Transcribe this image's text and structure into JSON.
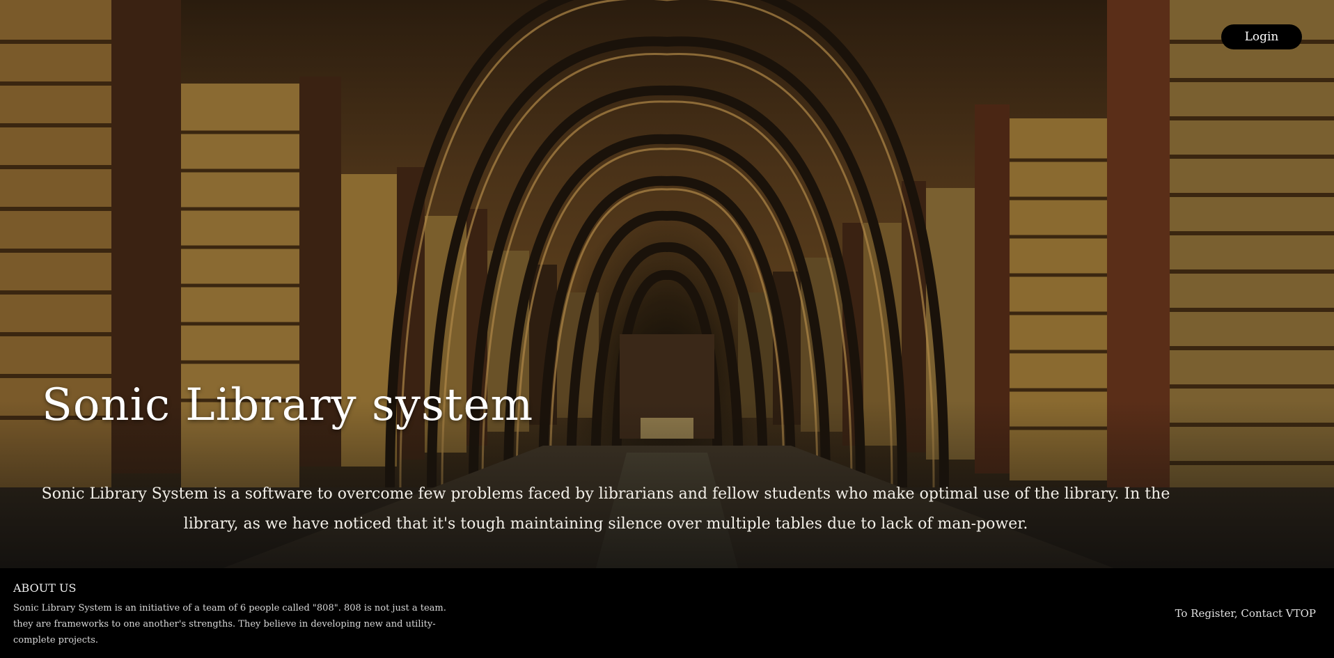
{
  "header": {
    "login_label": "Login"
  },
  "hero": {
    "title": "Sonic Library system",
    "description": "Sonic Library System is a software to overcome few problems faced by librarians and fellow students who make optimal use of the library. In the library, as we have noticed that it's tough maintaining silence over multiple tables due to lack of man-power."
  },
  "footer": {
    "about_heading": "ABOUT US",
    "about_text": "Sonic Library System is an initiative of a team of 6 people called \"808\". 808 is not just a team. they are frameworks to one another's strengths. They believe in developing new and utility-complete projects.",
    "register_text": "To Register, Contact VTOP"
  },
  "colors": {
    "footer_background": "#000000",
    "login_button_background": "#000000",
    "hero_text": "#ffffff"
  }
}
